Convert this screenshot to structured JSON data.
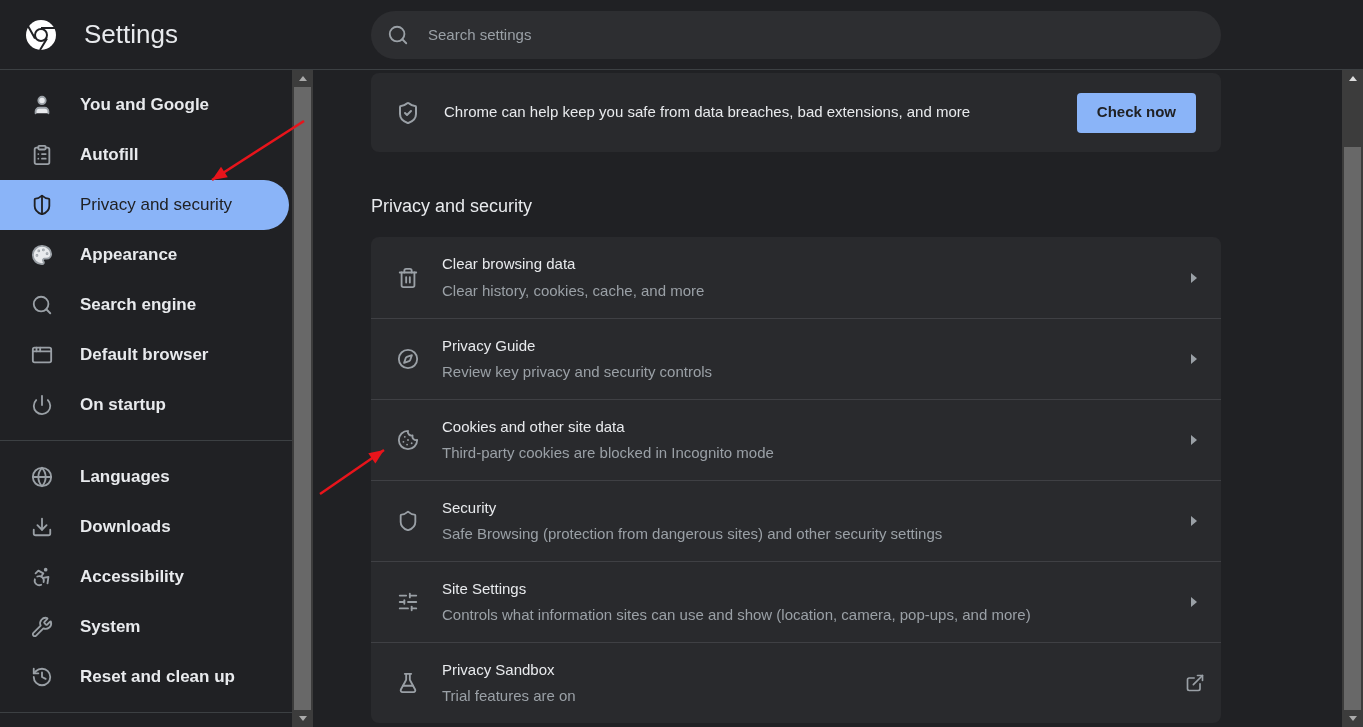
{
  "header": {
    "title": "Settings",
    "search": {
      "placeholder": "Search settings"
    }
  },
  "sidebar": {
    "groups": [
      {
        "items": [
          {
            "label": "You and Google",
            "selected": false
          },
          {
            "label": "Autofill",
            "selected": false
          },
          {
            "label": "Privacy and security",
            "selected": true
          },
          {
            "label": "Appearance",
            "selected": false
          },
          {
            "label": "Search engine",
            "selected": false
          },
          {
            "label": "Default browser",
            "selected": false
          },
          {
            "label": "On startup",
            "selected": false
          }
        ]
      },
      {
        "items": [
          {
            "label": "Languages",
            "selected": false
          },
          {
            "label": "Downloads",
            "selected": false
          },
          {
            "label": "Accessibility",
            "selected": false
          },
          {
            "label": "System",
            "selected": false
          },
          {
            "label": "Reset and clean up",
            "selected": false
          }
        ]
      }
    ]
  },
  "safety_check": {
    "text": "Chrome can help keep you safe from data breaches, bad extensions, and more",
    "button": "Check now"
  },
  "section": {
    "title": "Privacy and security",
    "rows": [
      {
        "title": "Clear browsing data",
        "subtitle": "Clear history, cookies, cache, and more",
        "kind": "arrow"
      },
      {
        "title": "Privacy Guide",
        "subtitle": "Review key privacy and security controls",
        "kind": "arrow"
      },
      {
        "title": "Cookies and other site data",
        "subtitle": "Third-party cookies are blocked in Incognito mode",
        "kind": "arrow"
      },
      {
        "title": "Security",
        "subtitle": "Safe Browsing (protection from dangerous sites) and other security settings",
        "kind": "arrow"
      },
      {
        "title": "Site Settings",
        "subtitle": "Controls what information sites can use and show (location, camera, pop-ups, and more)",
        "kind": "arrow"
      },
      {
        "title": "Privacy Sandbox",
        "subtitle": "Trial features are on",
        "kind": "external"
      }
    ]
  }
}
